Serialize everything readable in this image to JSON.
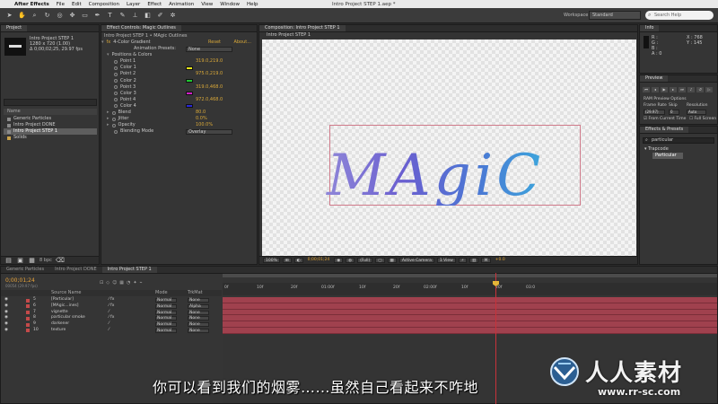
{
  "menubar": {
    "app": "After Effects",
    "items": [
      "File",
      "Edit",
      "Composition",
      "Layer",
      "Effect",
      "Animation",
      "View",
      "Window",
      "Help"
    ],
    "doc_title": "Intro Project STEP 1.aep *"
  },
  "toolbar": {
    "workspace_label": "Workspace:",
    "workspace_value": "Standard",
    "search_placeholder": "Search Help"
  },
  "project": {
    "tab": "Project",
    "item_name": "Intro Project STEP 1",
    "dims": "1280 x 720 (1.00)",
    "duration": "Δ 0;00;02;25, 29.97 fps",
    "column_name": "Name",
    "items": [
      "Generic Particles",
      "Intro Project DONE",
      "Intro Project STEP 1",
      "Solids"
    ],
    "bpc": "8 bpc"
  },
  "effect_controls": {
    "tab": "Effect Controls: Magic Outlines",
    "header": "Intro Project STEP 1 • MAgic Outlines",
    "effect_name": "4-Color Gradient",
    "reset": "Reset",
    "about": "About...",
    "presets_label": "Animation Presets:",
    "presets_value": "None",
    "group": "Positions & Colors",
    "rows": [
      {
        "name": "Point 1",
        "value": "319.0,219.0"
      },
      {
        "name": "Color 1",
        "value": ""
      },
      {
        "name": "Point 2",
        "value": "975.0,219.0"
      },
      {
        "name": "Color 2",
        "value": ""
      },
      {
        "name": "Point 3",
        "value": "319.0,468.0"
      },
      {
        "name": "Color 3",
        "value": ""
      },
      {
        "name": "Point 4",
        "value": "972.0,468.0"
      },
      {
        "name": "Color 4",
        "value": ""
      }
    ],
    "color1": "#e8e81a",
    "color2": "#20c832",
    "color3": "#d020c8",
    "color4": "#2828d8",
    "blend_label": "Blend",
    "blend_value": "80.0",
    "jitter_label": "Jitter",
    "jitter_value": "0.0%",
    "opacity_label": "Opacity",
    "opacity_value": "100.0%",
    "blending_label": "Blending Mode",
    "blending_value": "Overlay"
  },
  "composition": {
    "tab": "Composition: Intro Project STEP 1",
    "subtab": "Intro Project STEP 1",
    "zoom": "100%",
    "timecode": "0;00;01;24",
    "resolution": "(Full)",
    "camera": "Active Camera",
    "views": "1 View",
    "offset": "+0.0",
    "word": "MAgiC"
  },
  "info": {
    "tab": "Info",
    "r": "R :",
    "g": "G :",
    "b": "B :",
    "a": "A : 0",
    "x": "X : 768",
    "y": "Y : 145"
  },
  "preview": {
    "tab": "Preview",
    "ram_options": "RAM Preview Options",
    "frame_rate_label": "Frame Rate",
    "skip_label": "Skip",
    "resolution_label": "Resolution",
    "frame_rate_value": "(29.97)",
    "skip_value": "0",
    "resolution_value": "Auto",
    "from_current": "From Current Time",
    "full_screen": "Full Screen"
  },
  "effects_presets": {
    "tab": "Effects & Presets",
    "search": "particular",
    "category": "▾ Trapcode",
    "item": "Particular"
  },
  "timeline": {
    "tabs": [
      "Generic Particles",
      "Intro Project DONE",
      "Intro Project STEP 1"
    ],
    "timecode": "0;00;01;24",
    "timecode_sub": "00054 (29.97 fps)",
    "col_source": "Source Name",
    "col_mode": "Mode",
    "col_trkmat": "TrkMat",
    "col_parent": "Parent",
    "layers": [
      {
        "num": "5",
        "name": "[Particular]",
        "mode": "Normal",
        "parent": "None",
        "color": "#c44a4a"
      },
      {
        "num": "6",
        "name": "[MAgic...ines]",
        "mode": "Normal",
        "parent": "Alpha",
        "color": "#c44a4a"
      },
      {
        "num": "7",
        "name": "vignette",
        "mode": "Normal",
        "parent": "None",
        "color": "#c44a4a"
      },
      {
        "num": "8",
        "name": "particular smoke",
        "mode": "Normal",
        "parent": "None",
        "color": "#c44a4a"
      },
      {
        "num": "9",
        "name": "darkener",
        "mode": "Normal",
        "parent": "None",
        "color": "#c44a4a"
      },
      {
        "num": "10",
        "name": "texture",
        "mode": "Normal",
        "parent": "None",
        "color": "#c44a4a"
      }
    ],
    "ruler": [
      "0f",
      "10f",
      "20f",
      "01:00f",
      "10f",
      "20f",
      "02:00f",
      "10f",
      "20f",
      "03:0"
    ]
  },
  "subtitle": "你可以看到我们的烟雾……虽然自己看起来不咋地",
  "watermark": {
    "brand": "人人素材",
    "url": "www.rr-sc.com"
  }
}
